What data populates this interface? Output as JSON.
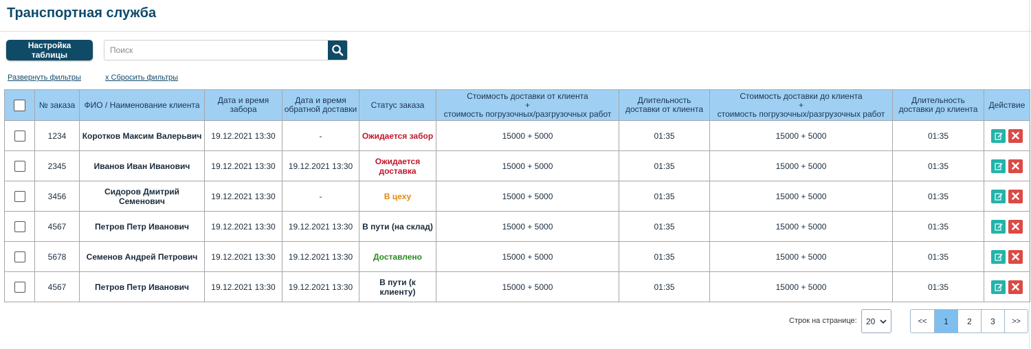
{
  "page": {
    "title": "Транспортная служба"
  },
  "toolbar": {
    "settings_label": "Настройка таблицы",
    "search_placeholder": "Поиск",
    "expand_filters": "Развернуть фильтры",
    "reset_filters": "x Сбросить фильтры"
  },
  "table": {
    "headers": {
      "order": "№ заказа",
      "client": "ФИО / Наименование клиента",
      "pickup_dt": "Дата и время забора",
      "return_dt": "Дата и время обратной доставки",
      "status": "Статус заказа",
      "cost_from_1": "Стоимость доставки от клиента",
      "cost_from_2": "+",
      "cost_from_3": "стоимость погрузочных/разгрузочных работ",
      "dur_from": "Длительность доставки от клиента",
      "cost_to_1": "Стоимость доставки до клиента",
      "cost_to_2": "+",
      "cost_to_3": "стоимость погрузочных/разгрузочных работ",
      "dur_to": "Длительность доставки до клиента",
      "action": "Действие"
    },
    "rows": [
      {
        "order": "1234",
        "client": "Коротков Максим Валерьвич",
        "pickup": "19.12.2021 13:30",
        "return": "-",
        "status": "Ожидается забор",
        "cost_from": "15000 + 5000",
        "dur_from": "01:35",
        "cost_to": "15000 + 5000",
        "dur_to": "01:35"
      },
      {
        "order": "2345",
        "client": "Иванов Иван Иванович",
        "pickup": "19.12.2021 13:30",
        "return": "19.12.2021 13:30",
        "status": "Ожидается доставка",
        "cost_from": "15000 + 5000",
        "dur_from": "01:35",
        "cost_to": "15000 + 5000",
        "dur_to": "01:35"
      },
      {
        "order": "3456",
        "client": "Сидоров Дмитрий Семенович",
        "pickup": "19.12.2021 13:30",
        "return": "-",
        "status": "В цеху",
        "cost_from": "15000 + 5000",
        "dur_from": "01:35",
        "cost_to": "15000 + 5000",
        "dur_to": "01:35"
      },
      {
        "order": "4567",
        "client": "Петров Петр Иванович",
        "pickup": "19.12.2021 13:30",
        "return": "19.12.2021 13:30",
        "status": "В пути (на склад)",
        "cost_from": "15000 + 5000",
        "dur_from": "01:35",
        "cost_to": "15000 + 5000",
        "dur_to": "01:35"
      },
      {
        "order": "5678",
        "client": "Семенов Андрей Петрович",
        "pickup": "19.12.2021 13:30",
        "return": "19.12.2021 13:30",
        "status": "Доставлено",
        "cost_from": "15000 + 5000",
        "dur_from": "01:35",
        "cost_to": "15000 + 5000",
        "dur_to": "01:35"
      },
      {
        "order": "4567",
        "client": "Петров Петр Иванович",
        "pickup": "19.12.2021 13:30",
        "return": "19.12.2021 13:30",
        "status": "В пути (к клиенту)",
        "cost_from": "15000 + 5000",
        "dur_from": "01:35",
        "cost_to": "15000 + 5000",
        "dur_to": "01:35"
      }
    ],
    "status_colors": [
      "#c0152a",
      "#c0152a",
      "#e08a12",
      "#1a2b3c",
      "#2a8a22",
      "#1a2b3c"
    ],
    "header_bg": "#9fd0f4",
    "edit_icon": "edit-icon",
    "delete_icon": "close-icon"
  },
  "pagination": {
    "rows_label": "Строк на странице:",
    "rows_per_page": "20",
    "first": "<<",
    "pages": [
      "1",
      "2",
      "3"
    ],
    "active_page": "1",
    "last": ">>"
  },
  "colors": {
    "brand": "#0f4a66",
    "active_page": "#7fbff0"
  }
}
